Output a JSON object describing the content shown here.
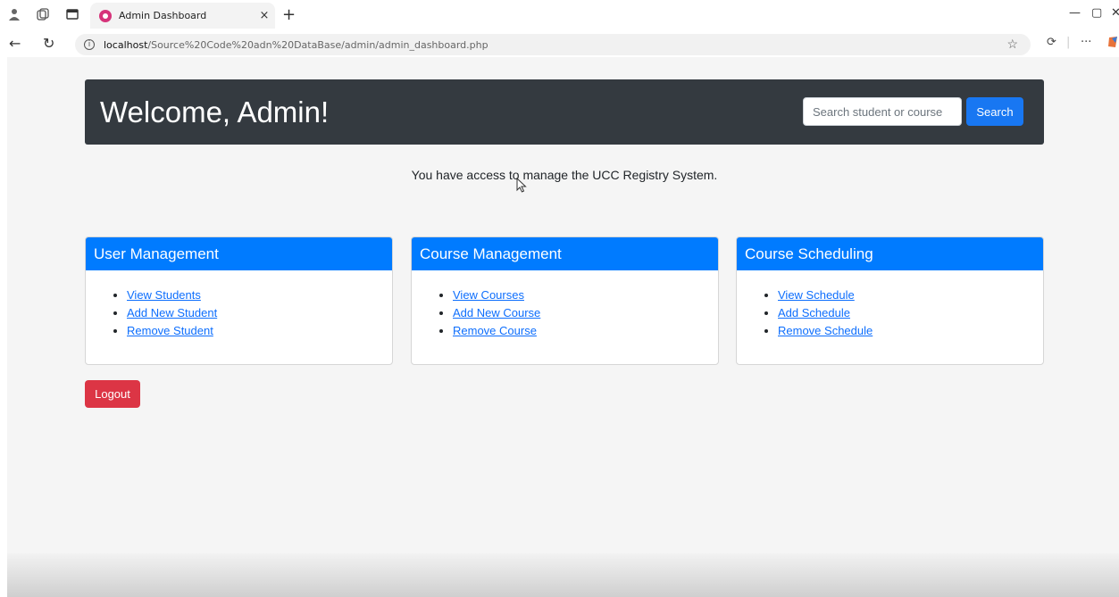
{
  "browser": {
    "tab_title": "Admin Dashboard",
    "tab_close": "×",
    "new_tab": "+",
    "url_host": "localhost",
    "url_path": "/Source%20Code%20adn%20DataBase/admin/admin_dashboard.php",
    "more_label": "···"
  },
  "header": {
    "title": "Welcome, Admin!",
    "search_placeholder": "Search student or course",
    "search_label": "Search"
  },
  "access_message": "You have access to manage the UCC Registry System.",
  "cards": [
    {
      "title": "User Management",
      "links": [
        "View Students",
        "Add New Student",
        "Remove Student"
      ]
    },
    {
      "title": "Course Management",
      "links": [
        "View Courses",
        "Add New Course",
        "Remove Course"
      ]
    },
    {
      "title": "Course Scheduling",
      "links": [
        "View Schedule",
        "Add Schedule",
        "Remove Schedule"
      ]
    }
  ],
  "logout_label": "Logout",
  "colors": {
    "header_bg": "#343a40",
    "card_header": "#007bff",
    "search_button": "#1877f2",
    "logout": "#dc3545"
  }
}
